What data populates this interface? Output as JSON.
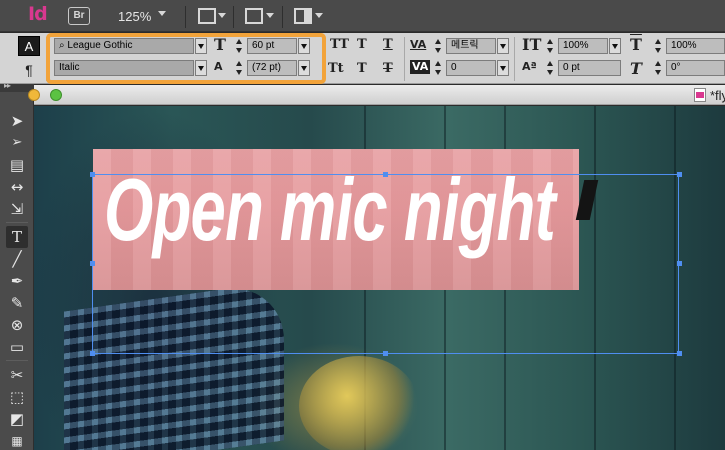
{
  "app_bar": {
    "logo": "Id",
    "bridge": "Br",
    "zoom": "125%",
    "icons": [
      "view-options-icon",
      "screen-mode-icon",
      "arrange-documents-icon"
    ]
  },
  "control_panel": {
    "mode_character": "A",
    "mode_paragraph": "¶",
    "font_family": "League Gothic",
    "font_style": "Italic",
    "font_size": "60 pt",
    "leading": "(72 pt)",
    "kerning": "메트릭",
    "tracking": "0",
    "vertical_scale": "100%",
    "baseline_shift": "0 pt",
    "horizontal_scale": "100%",
    "skew": "0°",
    "glyphs": {
      "all_caps": "TT",
      "superscript": "T",
      "underline": "T",
      "small_caps": "Tt",
      "subscript": "T",
      "strikethrough": "T",
      "size_icon": "T",
      "leading_icon": "A",
      "kerning_icon": "VA",
      "tracking_icon": "VA",
      "vscale_icon": "IT",
      "baseline_icon": "Aª",
      "hscale_icon": "T",
      "skew_icon": "T"
    }
  },
  "tools": [
    "selection",
    "direct-selection",
    "page",
    "gap",
    "content-collector",
    "type",
    "line",
    "pen",
    "pencil",
    "ellipse-frame",
    "rectangle",
    "scissors",
    "free-transform",
    "gradient-swatch",
    "gradient-feather"
  ],
  "document": {
    "tab_title": "*flyer",
    "headline": "Open mic night"
  },
  "colors": {
    "highlight": "#f2a33a",
    "selection": "#4f8ef0",
    "headline_bg": "#e8a3a6",
    "logo": "#d9388f"
  }
}
